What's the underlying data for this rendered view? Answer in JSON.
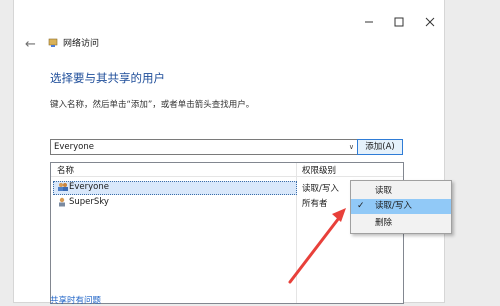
{
  "window": {
    "controls": {
      "minimize": "–",
      "maximize": "☐",
      "close": "✕"
    },
    "breadcrumb": "网络访问"
  },
  "page": {
    "heading": "选择要与其共享的用户",
    "instruction": "键入名称，然后单击“添加”，或者单击箭头查找用户。"
  },
  "input": {
    "value": "Everyone"
  },
  "add_button": {
    "label": "添加(A)"
  },
  "list": {
    "columns": [
      "名称",
      "权限级别"
    ],
    "rows": [
      {
        "name": "Everyone",
        "permission": "读取/写入",
        "selected": true
      },
      {
        "name": "SuperSky",
        "permission": "所有者",
        "selected": false
      }
    ]
  },
  "menu": {
    "items": [
      {
        "label": "读取",
        "checked": false
      },
      {
        "label": "读取/写入",
        "checked": true
      },
      {
        "label": "删除",
        "checked": false
      }
    ]
  },
  "help_link": "共享时有问题",
  "annotation_color": "#e8403a"
}
